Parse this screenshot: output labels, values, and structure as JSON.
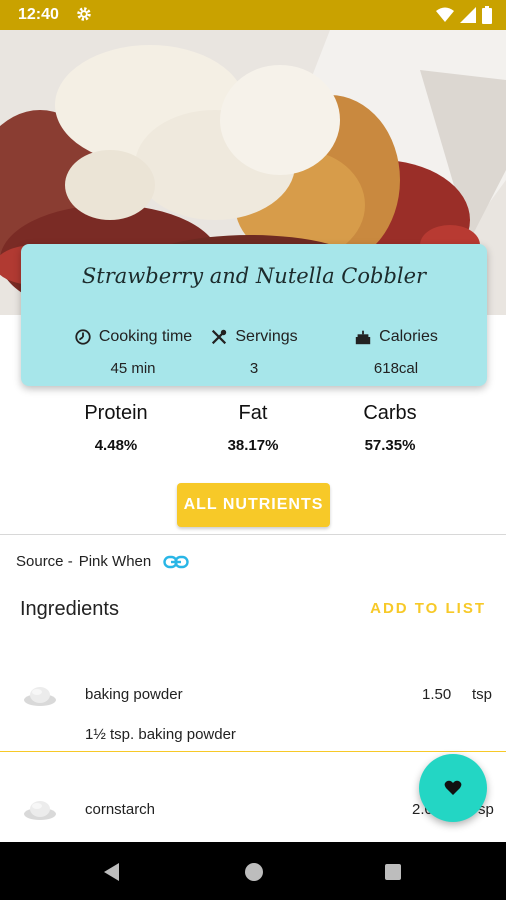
{
  "status_bar": {
    "time": "12:40",
    "icons": [
      "gear-icon",
      "wifi-icon",
      "signal-icon",
      "battery-icon"
    ],
    "color": "#c9a200"
  },
  "recipe": {
    "title": "Strawberry and Nutella Cobbler",
    "image": "cobbler-with-ice-cream"
  },
  "info": {
    "cooking_time_label": "Cooking time",
    "cooking_time_value": "45 min",
    "servings_label": "Servings",
    "servings_value": "3",
    "calories_label": "Calories",
    "calories_value": "618cal",
    "card_color": "#a7e6ea"
  },
  "nutrients": {
    "protein_label": "Protein",
    "protein_value": "4.48%",
    "fat_label": "Fat",
    "fat_value": "38.17%",
    "carbs_label": "Carbs",
    "carbs_value": "57.35%",
    "all_nutrients_label": "ALL NUTRIENTS"
  },
  "source": {
    "label": "Source -",
    "name": "Pink When"
  },
  "ingredients": {
    "title": "Ingredients",
    "add_to_list_label": "ADD TO LIST",
    "items": [
      {
        "name": "baking powder",
        "amount": "1.50",
        "unit": "tsp",
        "description": "1½ tsp. baking powder"
      },
      {
        "name": "cornstarch",
        "amount": "2.0",
        "unit": "sp"
      }
    ]
  },
  "accent_color": "#f7c928",
  "fab_color": "#23d6c4"
}
